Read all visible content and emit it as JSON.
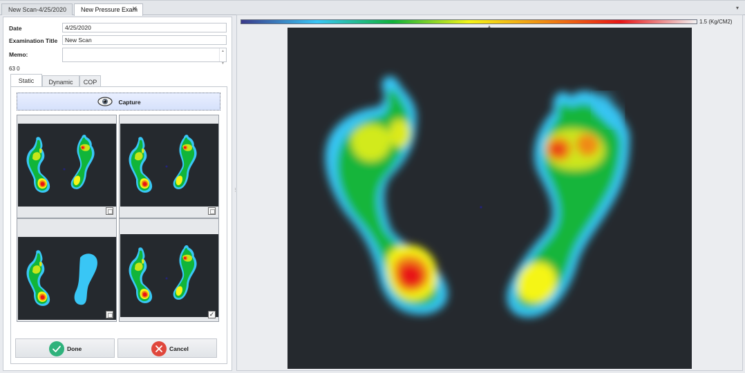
{
  "tabs": [
    {
      "label": "New Scan-4/25/2020",
      "active": false
    },
    {
      "label": "New Pressure Exam",
      "active": true
    }
  ],
  "tab_close_glyph": "✕",
  "tab_dropdown_glyph": "▾",
  "form": {
    "date_label": "Date",
    "date_value": "4/25/2020",
    "title_label": "Examination Title",
    "title_value": "New Scan",
    "memo_label": "Memo:",
    "memo_value": "",
    "counter": "63 0"
  },
  "inner_tabs": [
    {
      "label": "Static",
      "active": true
    },
    {
      "label": "Dynamic",
      "active": false
    },
    {
      "label": "COP",
      "active": false
    }
  ],
  "capture_label": "Capture",
  "thumbnails": [
    {
      "checked": false
    },
    {
      "checked": false
    },
    {
      "checked": false
    },
    {
      "checked": true
    }
  ],
  "check_glyph": "✓",
  "done_label": "Done",
  "cancel_label": "Cancel",
  "scale": {
    "max_text": "1.5 (Kg/CM2)",
    "gradient_colors": [
      "#3a3a8a",
      "#39c6f5",
      "#10b23a",
      "#f5f516",
      "#f08a12",
      "#e81515",
      "#f2f2f2"
    ]
  },
  "colors": {
    "background": "#25292e",
    "done": "#2fb27c",
    "cancel": "#e0473c",
    "accent_tab": "#ffffff"
  },
  "icons": [
    "eye-icon",
    "close-icon",
    "chevron-down-icon",
    "checkmark-icon",
    "x-icon"
  ]
}
